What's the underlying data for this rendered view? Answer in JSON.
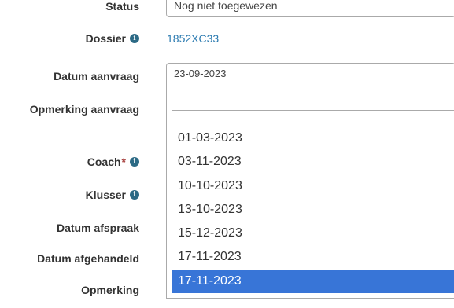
{
  "form": {
    "status": {
      "label": "Status",
      "value": "Nog niet toegewezen"
    },
    "dossier": {
      "label": "Dossier",
      "value": "1852XC33",
      "info_icon": "info-icon"
    },
    "datum_aanvraag": {
      "label": "Datum aanvraag",
      "value": "23-09-2023"
    },
    "opmerking_aanvraag": {
      "label": "Opmerking aanvraag"
    },
    "coach": {
      "label": "Coach",
      "required_mark": "*",
      "info_icon": "info-icon"
    },
    "klusser": {
      "label": "Klusser",
      "info_icon": "info-icon"
    },
    "datum_afspraak": {
      "label": "Datum afspraak"
    },
    "datum_afgehandeld": {
      "label": "Datum afgehandeld"
    },
    "opmerking": {
      "label": "Opmerking"
    }
  },
  "dropdown": {
    "search_value": "",
    "options": [
      {
        "label": "01-03-2023",
        "highlighted": false
      },
      {
        "label": "03-11-2023",
        "highlighted": false
      },
      {
        "label": "10-10-2023",
        "highlighted": false
      },
      {
        "label": "13-10-2023",
        "highlighted": false
      },
      {
        "label": "15-12-2023",
        "highlighted": false
      },
      {
        "label": "17-11-2023",
        "highlighted": false
      },
      {
        "label": "17-11-2023",
        "highlighted": true
      }
    ]
  },
  "colors": {
    "highlight": "#3875d7",
    "link": "#2a7ab0",
    "info_icon": "#2c6a85",
    "required": "#a94442"
  }
}
